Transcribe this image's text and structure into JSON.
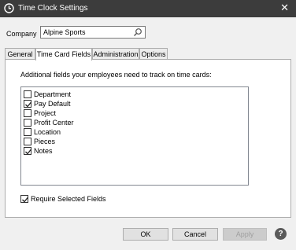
{
  "window": {
    "title": "Time Clock Settings",
    "close": "✕"
  },
  "company": {
    "label": "Company",
    "value": "Alpine Sports"
  },
  "tabs": [
    {
      "label": "General",
      "active": false
    },
    {
      "label": "Time Card Fields",
      "active": true
    },
    {
      "label": "Administration",
      "active": false
    },
    {
      "label": "Options",
      "active": false
    }
  ],
  "panel": {
    "description": "Additional fields your employees need to track on time cards:"
  },
  "fields": [
    {
      "label": "Department",
      "checked": false
    },
    {
      "label": "Pay Default",
      "checked": true
    },
    {
      "label": "Project",
      "checked": false
    },
    {
      "label": "Profit Center",
      "checked": false
    },
    {
      "label": "Location",
      "checked": false
    },
    {
      "label": "Pieces",
      "checked": false
    },
    {
      "label": "Notes",
      "checked": true
    }
  ],
  "require_selected": {
    "label": "Require Selected Fields",
    "checked": true
  },
  "buttons": {
    "ok": "OK",
    "cancel": "Cancel",
    "apply": "Apply",
    "help": "?"
  }
}
